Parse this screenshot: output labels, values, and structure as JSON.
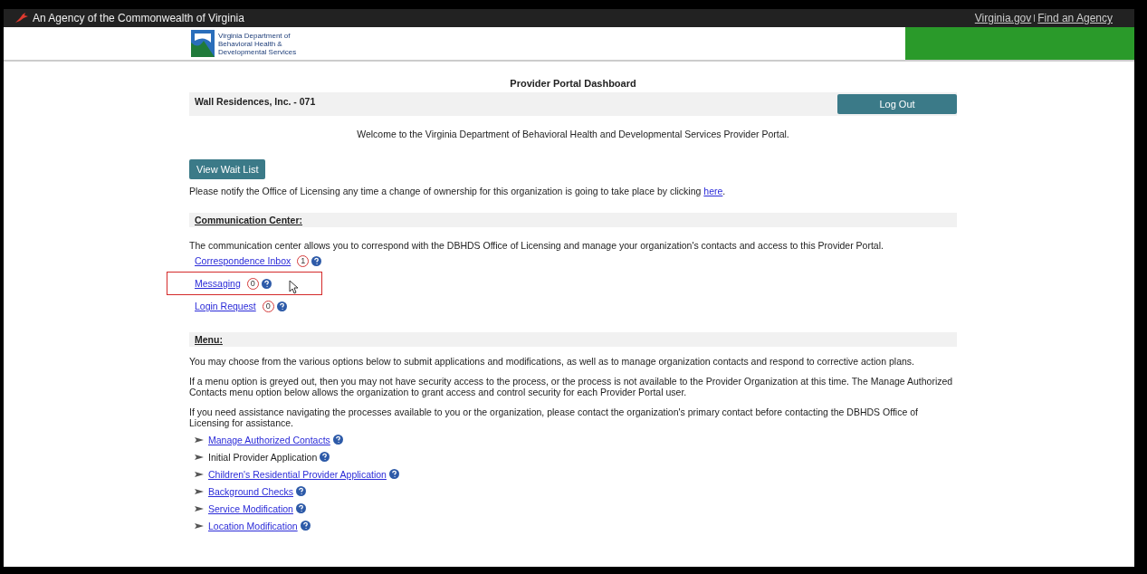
{
  "top_bar": {
    "agency": "An Agency of the Commonwealth of Virginia",
    "links": [
      "Virginia.gov",
      "Find an Agency"
    ]
  },
  "logo": {
    "lines": [
      "Virginia Department of",
      "Behavioral Health &",
      "Developmental Services"
    ]
  },
  "page_title": "Provider Portal Dashboard",
  "organization": "Wall Residences, Inc. - 071",
  "logout_button": "Log Out",
  "welcome": "Welcome to the Virginia Department of Behavioral Health and Developmental Services Provider Portal.",
  "wait_list_button": "View Wait List",
  "notice": {
    "text": "Please notify the Office of Licensing any time a change of ownership for this organization is going to take place by clicking ",
    "link": "here",
    "end": "."
  },
  "communication_center": {
    "heading": "Communication Center:",
    "text": "The communication center allows you to correspond with the DBHDS Office of Licensing and manage your organization's contacts and access to this Provider Portal.",
    "items": [
      {
        "label": "Correspondence Inbox",
        "count": "1",
        "highlighted": false
      },
      {
        "label": "Messaging",
        "count": "0",
        "highlighted": true
      },
      {
        "label": "Login Request",
        "count": "0",
        "highlighted": false
      }
    ]
  },
  "menu": {
    "heading": "Menu:",
    "paragraphs": [
      "You may choose from the various options below to submit applications and modifications, as well as to manage organization contacts and respond to corrective action plans.",
      "If a menu option is greyed out, then you may not have security access to the process, or the process is not available to the Provider Organization at this time. The Manage Authorized Contacts menu option below allows the organization to grant access and control security for each Provider Portal user.",
      "If you need assistance navigating the processes available to you or the organization, please contact the organization's primary contact before contacting the DBHDS Office of Licensing for assistance."
    ],
    "items": [
      {
        "label": "Manage Authorized Contacts",
        "disabled": false
      },
      {
        "label": "Initial Provider Application",
        "disabled": true
      },
      {
        "label": "Children's Residential Provider Application",
        "disabled": false
      },
      {
        "label": "Background Checks",
        "disabled": false
      },
      {
        "label": "Service Modification",
        "disabled": false
      },
      {
        "label": "Location Modification",
        "disabled": false
      }
    ]
  }
}
